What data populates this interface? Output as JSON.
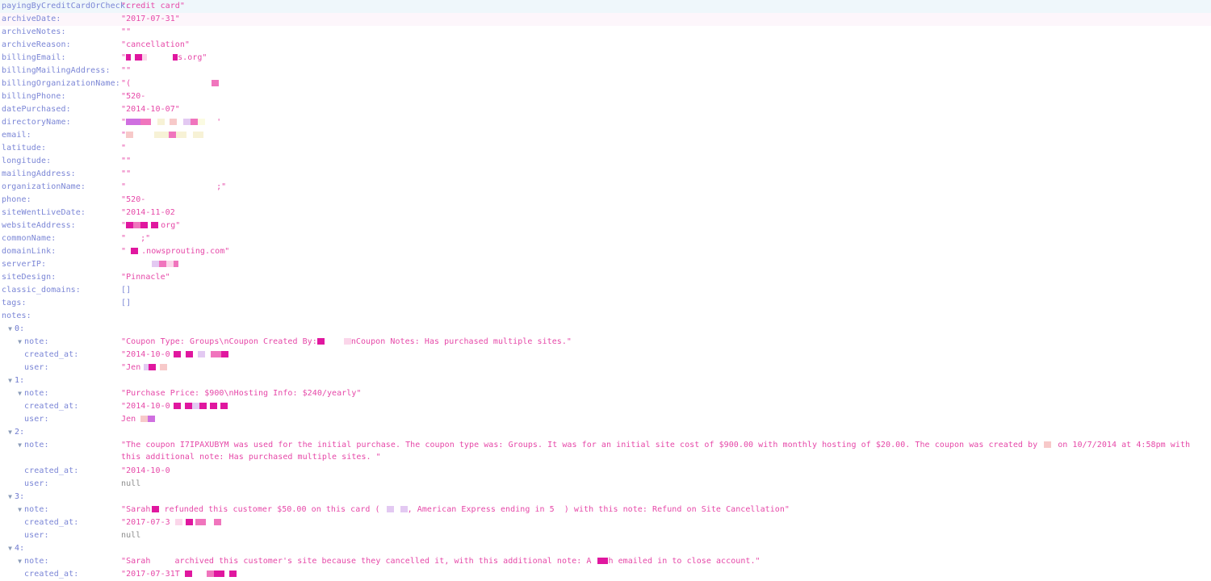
{
  "viewer": {
    "type": "json-object-inspector",
    "colors": {
      "key": "#7b86d6",
      "value": "#e648a8",
      "null": "#8d8d8d",
      "twisty": "#8a9bb8",
      "row_highlight": "#eff7fb",
      "background": "#ffffff"
    },
    "twisty_glyph": "▼"
  },
  "fields": [
    {
      "key": "payingByCreditCardOrCheck:",
      "value": "\"credit card\"",
      "kind": "string"
    },
    {
      "key": "archiveDate:",
      "value": "\"2017-07-31\"",
      "kind": "string"
    },
    {
      "key": "archiveNotes:",
      "value": "\"\"",
      "kind": "string"
    },
    {
      "key": "archiveReason:",
      "value": "\"cancellation\"",
      "kind": "string"
    },
    {
      "key": "billingEmail:",
      "value": "\"",
      "kind": "redacted",
      "suffix": "s.org\""
    },
    {
      "key": "billingMailingAddress:",
      "value": "\"\"",
      "kind": "string"
    },
    {
      "key": "billingOrganizationName:",
      "value": "\"(",
      "kind": "redacted",
      "suffix": ""
    },
    {
      "key": "billingPhone:",
      "value": "\"520-",
      "kind": "partial"
    },
    {
      "key": "datePurchased:",
      "value": "\"2014-10-07\"",
      "kind": "string"
    },
    {
      "key": "directoryName:",
      "value": "\"",
      "kind": "redacted",
      "suffix": "'"
    },
    {
      "key": "email:",
      "value": "\"",
      "kind": "redacted",
      "suffix": ""
    },
    {
      "key": "latitude:",
      "value": "\"",
      "kind": "partial"
    },
    {
      "key": "longitude:",
      "value": "\"\"",
      "kind": "string"
    },
    {
      "key": "mailingAddress:",
      "value": "\"\"",
      "kind": "string"
    },
    {
      "key": "organizationName:",
      "value": "\"",
      "kind": "redacted",
      "suffix": ";\""
    },
    {
      "key": "phone:",
      "value": "\"520-",
      "kind": "partial"
    },
    {
      "key": "siteWentLiveDate:",
      "value": "\"2014-11-02",
      "kind": "partial"
    },
    {
      "key": "websiteAddress:",
      "value": "\"",
      "kind": "redacted",
      "suffix": "org\""
    },
    {
      "key": "commonName:",
      "value": "\"",
      "kind": "redacted",
      "suffix": ";\""
    },
    {
      "key": "domainLink:",
      "value": "\"",
      "kind": "redacted",
      "suffix": ".nowsprouting.com\""
    },
    {
      "key": "serverIP:",
      "value": "",
      "kind": "redacted",
      "suffix": ""
    },
    {
      "key": "siteDesign:",
      "value": "\"Pinnacle\"",
      "kind": "string"
    },
    {
      "key": "classic_domains:",
      "value": "[]",
      "kind": "array"
    },
    {
      "key": "tags:",
      "value": "[]",
      "kind": "array"
    },
    {
      "key": "notes:",
      "value": "",
      "kind": "object"
    }
  ],
  "notes": [
    {
      "index": "0:",
      "note_key": "note:",
      "note_value": "\"Coupon Type: Groups\\nCoupon Created By:",
      "note_value_tail": "nCoupon Notes: Has purchased multiple sites.\"",
      "created_at_key": "created_at:",
      "created_at_value": "\"2014-10-0",
      "user_key": "user:",
      "user_value": "\"Jen"
    },
    {
      "index": "1:",
      "note_key": "note:",
      "note_value": "\"Purchase Price: $900\\nHosting Info: $240/yearly\"",
      "note_value_tail": "",
      "created_at_key": "created_at:",
      "created_at_value": "\"2014-10-0",
      "user_key": "user:",
      "user_value": "Jen"
    },
    {
      "index": "2:",
      "note_key": "note:",
      "note_value": "\"The coupon I7IPAXUBYM was used for the initial purchase. The coupon type was: Groups. It was for an initial site cost of $900.00 with monthly hosting of $20.00. The coupon was created by",
      "note_value_tail": "on 10/7/2014 at 4:58pm with this additional note: Has purchased multiple sites. \"",
      "created_at_key": "created_at:",
      "created_at_value": "\"2014-10-0",
      "user_key": "user:",
      "user_value": "null"
    },
    {
      "index": "3:",
      "note_key": "note:",
      "note_value": "\"Sarah",
      "note_value_mid": "refunded this customer $50.00 on this card (",
      "note_value_tail": ", American Express ending in 5",
      "note_value_end": ") with this note: Refund on Site Cancellation\"",
      "created_at_key": "created_at:",
      "created_at_value": "\"2017-07-3",
      "user_key": "user:",
      "user_value": "null"
    },
    {
      "index": "4:",
      "note_key": "note:",
      "note_value": "\"Sarah",
      "note_value_mid": "archived this customer's site because they cancelled it, with this additional note: A",
      "note_value_tail": "h emailed in to close account.\"",
      "created_at_key": "created_at:",
      "created_at_value": "\"2017-07-31T"
    }
  ]
}
